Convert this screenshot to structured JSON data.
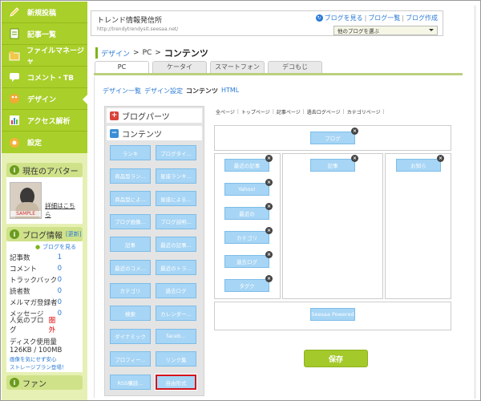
{
  "sidebar": {
    "nav": [
      {
        "label": "新規投稿",
        "icon": "pencil-icon",
        "color": "#fbd24a"
      },
      {
        "label": "記事一覧",
        "icon": "document-icon",
        "color": "#fff"
      },
      {
        "label": "ファイルマネージャ",
        "icon": "folder-icon",
        "color": "#f2c84b"
      },
      {
        "label": "コメント・TB",
        "icon": "comment-icon",
        "color": "#e8f5a0"
      },
      {
        "label": "デザイン",
        "icon": "palette-icon",
        "color": "#f3a935"
      },
      {
        "label": "アクセス解析",
        "icon": "chart-icon",
        "color": "#fff"
      },
      {
        "label": "設定",
        "icon": "gear-icon",
        "color": "#f5b33a"
      }
    ],
    "avatar": {
      "title": "現在のアバター",
      "link": "詳細はこちら",
      "sample": "SAMPLE"
    },
    "blog_info": {
      "title": "ブログ情報",
      "update": "[更新]",
      "view": "ブログを見る",
      "stats": [
        {
          "label": "記事数",
          "value": "1"
        },
        {
          "label": "コメント",
          "value": "0"
        },
        {
          "label": "トラックバック",
          "value": "0"
        },
        {
          "label": "読者数",
          "value": "0"
        },
        {
          "label": "メルマガ登録者",
          "value": "0"
        },
        {
          "label": "メッセージ",
          "value": "0"
        },
        {
          "label": "人気のブログ",
          "value": "圏外"
        }
      ],
      "disk_label": "ディスク使用量",
      "disk_value": "126KB / 100MB",
      "disk_note1": "画像を気にせず安心",
      "disk_note2": "ストレージプラン登場！"
    },
    "fan": {
      "title": "ファン"
    }
  },
  "header": {
    "site_name": "トレンド情報発信所",
    "site_url": "http://trendytrendysit.seesaa.net/",
    "links": [
      "ブログを見る",
      "ブログ一覧",
      "ブログ作成"
    ],
    "blog_select": "他のブログを選ぶ"
  },
  "breadcrumb": {
    "items": [
      "デザイン",
      "PC"
    ],
    "current": "コンテンツ"
  },
  "tabs": [
    "PC",
    "ケータイ",
    "スマートフォン",
    "デコもじ"
  ],
  "subnav": {
    "items": [
      "デザイン一覧",
      "デザイン設定",
      "コンテンツ",
      "HTML"
    ],
    "current_index": 2
  },
  "left_panel": {
    "blog_parts": "ブログパーツ",
    "contents": "コンテンツ",
    "parts": [
      "ランキ",
      "ブログタイ...",
      "商品型ラン...",
      "星座ランキ...",
      "商品型によ...",
      "星座による...",
      "ブログ画像...",
      "ブログ説明...",
      "記事",
      "最近の記事...",
      "最近のコメ...",
      "最近のトラ...",
      "カテゴリ",
      "過去ログ",
      "検索",
      "カレンダー...",
      "ダイナミック",
      "faceb...",
      "プロフィー...",
      "リンク集",
      "RSS購読...",
      "自由形式"
    ],
    "selected_index": 21
  },
  "layout": {
    "page_links": [
      "全ページ",
      "トップページ",
      "記事ページ",
      "過去ログページ",
      "カテゴリページ"
    ],
    "header_widget": "ブログ",
    "left_col": [
      "最近の記事",
      "Yahoo!",
      "最近の",
      "カテゴリ",
      "過去ログ",
      "タグク"
    ],
    "center_col": [
      "記事"
    ],
    "right_col": [
      "お知ら"
    ],
    "footer_widget": "Seesaa Powered",
    "save_label": "保存"
  }
}
